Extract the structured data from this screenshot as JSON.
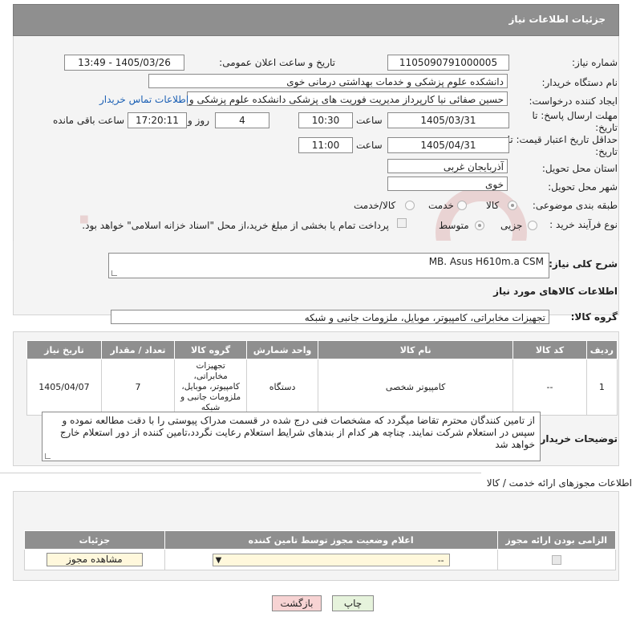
{
  "header": {
    "title": "جزئیات اطلاعات نیاز"
  },
  "fields": {
    "need_number_label": "شماره نیاز:",
    "need_number": "1105090791000005",
    "announce_label": "تاریخ و ساعت اعلان عمومی:",
    "announce_value": "1405/03/26 - 13:49",
    "buyer_label": "نام دستگاه خریدار:",
    "buyer_value": "دانشکده علوم پزشکی و خدمات بهداشتی درمانی خوی",
    "requester_label": "ایجاد کننده درخواست:",
    "requester_value": "حسین صفائی نیا کارپرداز مدیریت فوریت های پزشکی دانشکده علوم پزشکی و",
    "contact_link": "اطلاعات تماس خریدار",
    "deadline_label": "مهلت ارسال پاسخ: تا تاریخ:",
    "deadline_date": "1405/03/31",
    "time_label": "ساعت",
    "deadline_time": "10:30",
    "days_value": "4",
    "days_label": "روز و",
    "remaining_time": "17:20:11",
    "remaining_label": "ساعت باقی مانده",
    "validity_label": "حداقل تاریخ اعتبار قیمت: تا تاریخ:",
    "validity_date": "1405/04/31",
    "validity_time": "11:00",
    "province_label": "استان محل تحویل:",
    "province_value": "آذربایجان غربی",
    "city_label": "شهر محل تحویل:",
    "city_value": "خوی",
    "category_label": "طبقه بندی موضوعی:",
    "category_options": [
      "کالا",
      "خدمت",
      "کالا/خدمت"
    ],
    "process_label": "نوع فرآیند خرید :",
    "process_options": [
      "جزیی",
      "متوسط"
    ],
    "payment_text": "پرداخت تمام یا بخشی از مبلغ خرید،از محل \"اسناد خزانه اسلامی\" خواهد بود."
  },
  "description": {
    "label": "شرح کلی نیاز:",
    "value": "MB. Asus H610m.a CSM"
  },
  "goods": {
    "section_title": "اطلاعات کالاهای مورد نیاز",
    "group_label": "گروه کالا:",
    "group_value": "تجهیزات مخابراتی، کامپیوتر، موبایل، ملزومات جانبی و شبکه",
    "columns": [
      "ردیف",
      "کد کالا",
      "نام کالا",
      "واحد شمارش",
      "گروه کالا",
      "تعداد / مقدار",
      "تاریخ نیاز"
    ],
    "rows": [
      {
        "row": "1",
        "code": "--",
        "name": "کامپیوتر شخصی",
        "unit": "دستگاه",
        "group": "تجهیزات مخابراتی، کامپیوتر، موبایل، ملزومات جانبی و شبکه",
        "qty": "7",
        "date": "1405/04/07"
      }
    ]
  },
  "buyer_notes": {
    "label": "توضیحات خریدار:",
    "value": "از تامین کنندگان محترم تقاضا میگردد که مشخصات فنی درج شده در قسمت مدراک پیوستی را با دقت مطالعه نموده و سپس در استعلام شرکت نمایند. چناچه هر کدام از بندهای شرایط استعلام رعایت نگردد،تامین کننده از دور استعلام خارج خواهد شد"
  },
  "licenses": {
    "title": "اطلاعات مجوزهای ارائه خدمت / کالا",
    "columns": [
      "الزامی بودن ارائه مجوز",
      "اعلام وضعیت مجوز توسط تامین کننده",
      "جزئیات"
    ],
    "select_value": "--",
    "view_button": "مشاهده مجوز"
  },
  "footer": {
    "print_button": "چاپ",
    "back_button": "بازگشت"
  },
  "colors": {
    "header_bg": "#8f8f8f",
    "link": "#1a5fb4",
    "back_bg": "#f7d3d3",
    "print_bg": "#e6f3dc",
    "select_bg": "#fff8dc"
  }
}
